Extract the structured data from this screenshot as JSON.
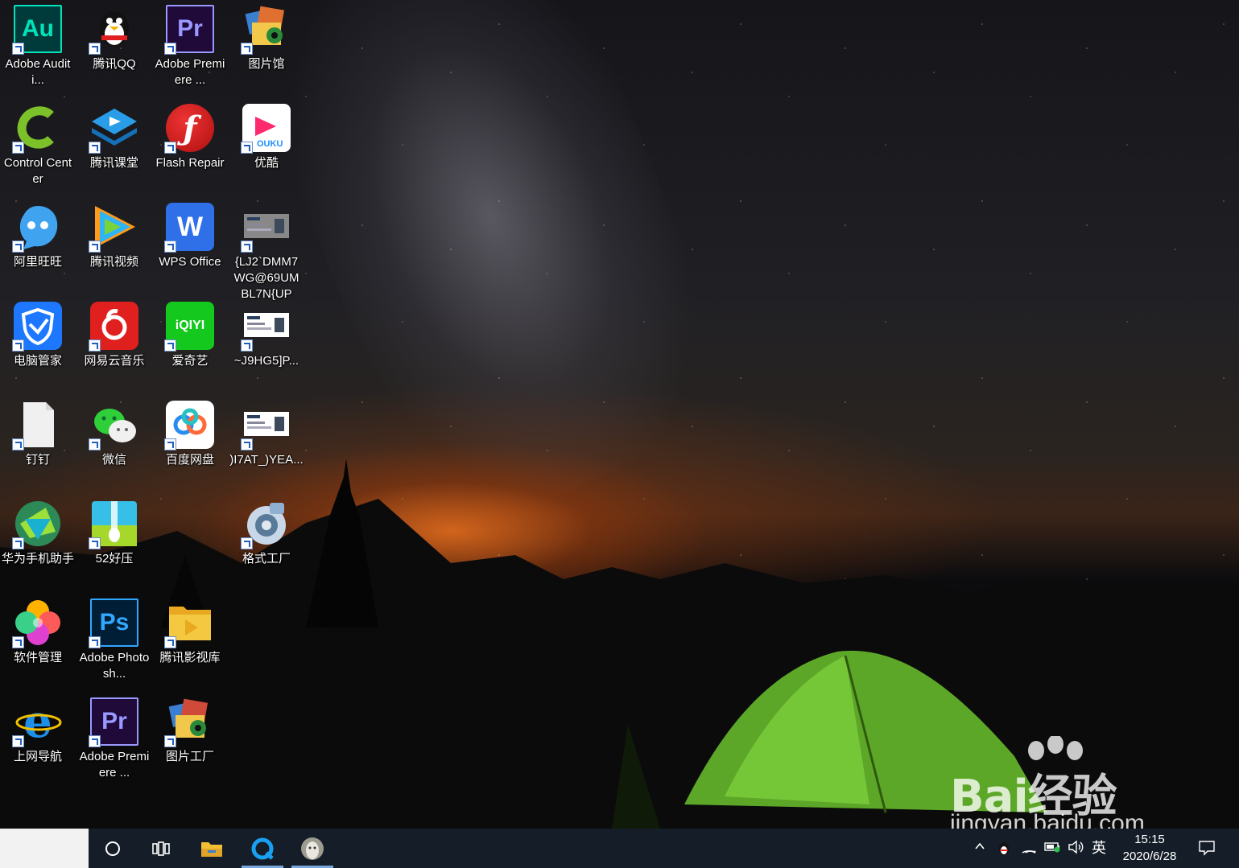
{
  "desktop": {
    "icons": [
      {
        "label": "Adobe Auditi...",
        "icon": "adobe-audition-icon",
        "color": "#00e4bb"
      },
      {
        "label": "腾讯QQ",
        "icon": "qq-penguin-icon",
        "color": "#000000"
      },
      {
        "label": "Adobe Premiere ...",
        "icon": "adobe-premiere-icon",
        "color": "#9999ff"
      },
      {
        "label": "图片馆",
        "icon": "picture-gallery-icon",
        "color": "#e07030"
      },
      {
        "label": "Control Center",
        "icon": "control-center-icon",
        "color": "#7cc12a"
      },
      {
        "label": "腾讯课堂",
        "icon": "tencent-classroom-icon",
        "color": "#2a9de8"
      },
      {
        "label": "Flash Repair",
        "icon": "flash-icon",
        "color": "#b01010"
      },
      {
        "label": "优酷",
        "icon": "youku-icon",
        "color": "#ff2a6d"
      },
      {
        "label": "阿里旺旺",
        "icon": "aliwangwang-icon",
        "color": "#3fa3f0"
      },
      {
        "label": "腾讯视频",
        "icon": "tencent-video-icon",
        "color": "#2fb4f5"
      },
      {
        "label": "WPS Office",
        "icon": "wps-office-icon",
        "color": "#2f6fe8"
      },
      {
        "label": "{LJ2`DMM7 WG@69UM BL7N{UP",
        "icon": "image-file-icon",
        "color": "#888888"
      },
      {
        "label": "电脑管家",
        "icon": "pc-manager-shield-icon",
        "color": "#1e78ff"
      },
      {
        "label": "网易云音乐",
        "icon": "netease-music-icon",
        "color": "#e0201e"
      },
      {
        "label": "爱奇艺",
        "icon": "iqiyi-icon",
        "color": "#14c81e"
      },
      {
        "label": "~J9HG5]P...",
        "icon": "image-file-icon",
        "color": "#ffffff"
      },
      {
        "label": "钉钉",
        "icon": "blank-document-icon",
        "color": "#f0f0f0"
      },
      {
        "label": "微信",
        "icon": "wechat-icon",
        "color": "#2fcf3a"
      },
      {
        "label": "百度网盘",
        "icon": "baidu-netdisk-icon",
        "color": "#2b8cf0"
      },
      {
        "label": ")I7AT_)YEA...",
        "icon": "image-file-icon",
        "color": "#ffffff"
      },
      {
        "label": "华为手机助手",
        "icon": "huawei-hisuite-icon",
        "color": "#20b0a0"
      },
      {
        "label": "52好压",
        "icon": "zip-archive-icon",
        "color": "#36c0e8"
      },
      {
        "label": "格式工厂",
        "icon": "format-factory-icon",
        "color": "#8fb0d0"
      },
      {
        "label": "软件管理",
        "icon": "software-manager-icon",
        "color": "#ff5a5a"
      },
      {
        "label": "Adobe Photosh...",
        "icon": "adobe-photoshop-icon",
        "color": "#31a8ff"
      },
      {
        "label": "腾讯影视库",
        "icon": "folder-video-icon",
        "color": "#f5c842"
      },
      {
        "label": "上网导航",
        "icon": "internet-explorer-icon",
        "color": "#1e8fe8"
      },
      {
        "label": "Adobe Premiere ...",
        "icon": "adobe-premiere-icon",
        "color": "#9999ff"
      },
      {
        "label": "图片工厂",
        "icon": "picture-factory-icon",
        "color": "#d04a3a"
      }
    ]
  },
  "icon_text": {
    "au": "Au",
    "pr": "Pr",
    "ps": "Ps",
    "wps": "W",
    "iqiyi": "iQIYI",
    "youku": "OUKU",
    "ie": "e"
  },
  "watermark": {
    "brand": "Bai经验",
    "url": "jingyan.baidu.com"
  },
  "taskbar": {
    "buttons": [
      {
        "name": "cortana-button",
        "icon": "circle-icon"
      },
      {
        "name": "task-view-button",
        "icon": "task-view-icon"
      },
      {
        "name": "file-explorer-button",
        "icon": "folder-icon"
      },
      {
        "name": "browser-button",
        "icon": "browser-icon"
      },
      {
        "name": "media-player-button",
        "icon": "user-avatar-icon"
      }
    ],
    "tray": {
      "input_method": "英",
      "time": "15:15",
      "date": "2020/6/28"
    }
  }
}
